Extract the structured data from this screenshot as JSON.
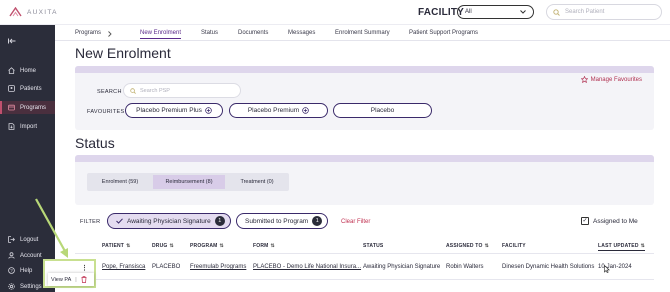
{
  "header": {
    "logo_text": "AUXITA",
    "facility_label": "FACILITY",
    "facility_value": "All",
    "search_placeholder": "Search Patient"
  },
  "sidebar": {
    "items": [
      {
        "label": "Home",
        "icon": "home-icon"
      },
      {
        "label": "Patients",
        "icon": "patients-icon"
      },
      {
        "label": "Programs",
        "icon": "programs-icon",
        "active": true
      },
      {
        "label": "Import",
        "icon": "import-icon"
      },
      {
        "label": "Logout",
        "icon": "logout-icon"
      },
      {
        "label": "Account",
        "icon": "account-icon"
      },
      {
        "label": "Help",
        "icon": "help-icon"
      },
      {
        "label": "Settings",
        "icon": "settings-icon"
      }
    ]
  },
  "tabs": [
    "Programs",
    "New Enrolment",
    "Status",
    "Documents",
    "Messages",
    "Enrolment Summary",
    "Patient Support Programs"
  ],
  "new_enrolment": {
    "title": "New Enrolment",
    "search_label": "SEARCH",
    "search_placeholder": "Search PSP",
    "manage_favourites": "Manage Favourites",
    "favourites_label": "FAVOURITES",
    "favourites": [
      "Placebo Premium Plus",
      "Placebo Premium",
      "Placebo"
    ]
  },
  "status": {
    "title": "Status",
    "subtabs": [
      "Enrolment (59)",
      "Reimbursement (8)",
      "Treatment (0)"
    ],
    "filter_label": "FILTER",
    "filters": [
      {
        "label": "Awaiting Physician Signature",
        "count": "1"
      },
      {
        "label": "Submitted to Program",
        "count": "1"
      }
    ],
    "clear_filter": "Clear Filter",
    "assigned_to_me": "Assigned to Me"
  },
  "table": {
    "headers": [
      "PATIENT",
      "DRUG",
      "PROGRAM",
      "FORM",
      "STATUS",
      "ASSIGNED TO",
      "FACILITY",
      "LAST UPDATED"
    ],
    "rows": [
      [
        "Pope, Fransisca",
        "PLACEBO",
        "Freemulab Programs",
        "PLACEBO - Demo Life National Insura...",
        "Awaiting Physician Signature",
        "Robin Walters",
        "Dinesen Dynamic Health Solutions",
        "10-Jan-2024"
      ]
    ]
  },
  "popup": {
    "view_pa": "View PA",
    "separator": "|"
  },
  "colors": {
    "sidebar_bg": "#2b2d3a",
    "accent_purple": "#5a2a8a",
    "accent_red": "#c03050",
    "highlight_green": "#c8e090"
  }
}
